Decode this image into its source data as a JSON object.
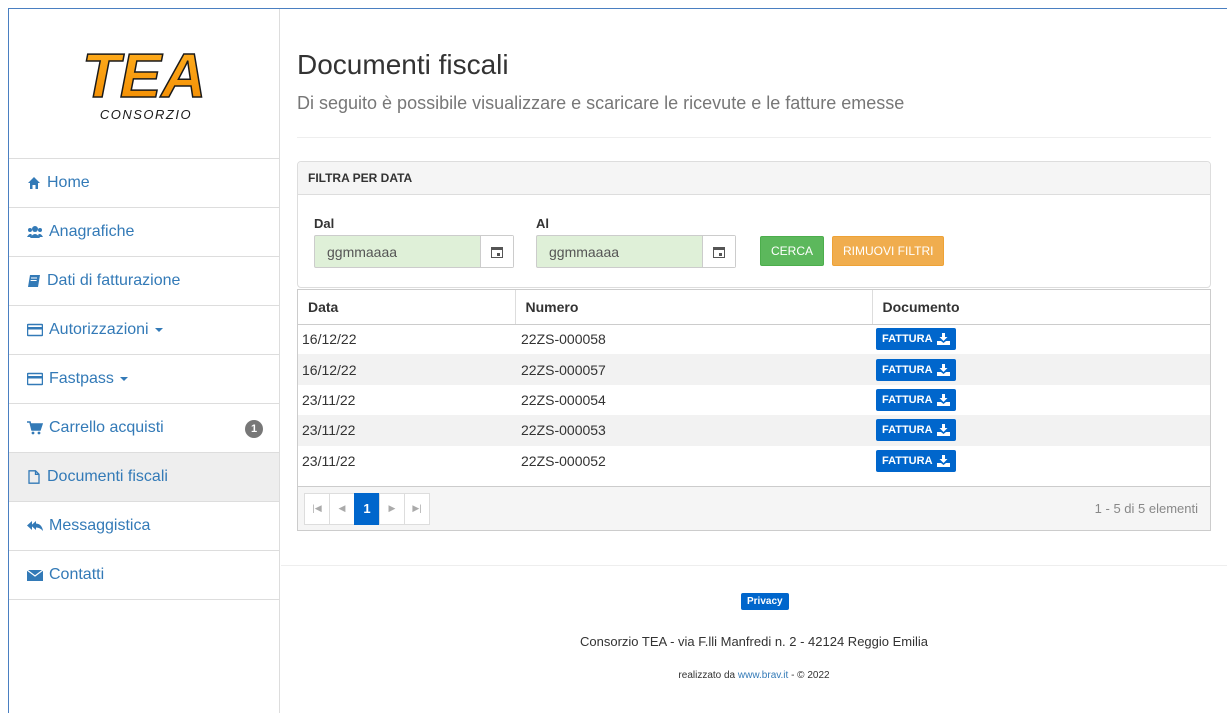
{
  "logo": {
    "wordmark": "TEA",
    "caption": "CONSORZIO"
  },
  "sidebar": {
    "items": [
      {
        "label": "Home",
        "icon": "home-icon"
      },
      {
        "label": "Anagrafiche",
        "icon": "users-icon"
      },
      {
        "label": "Dati di fatturazione",
        "icon": "book-icon"
      },
      {
        "label": "Autorizzazioni",
        "icon": "credit-card-icon"
      },
      {
        "label": "Fastpass",
        "icon": "credit-card-icon"
      },
      {
        "label": "Carrello acquisti",
        "icon": "cart-icon",
        "badge": "1"
      },
      {
        "label": "Documenti fiscali",
        "icon": "file-icon",
        "active": true
      },
      {
        "label": "Messaggistica",
        "icon": "reply-all-icon"
      },
      {
        "label": "Contatti",
        "icon": "envelope-icon"
      }
    ]
  },
  "header": {
    "title": "Documenti fiscali",
    "subtitle": "Di seguito è possibile visualizzare e scaricare le ricevute e le fatture emesse"
  },
  "filter": {
    "heading": "FILTRA PER DATA",
    "from_label": "Dal",
    "from_value": "ggmmaaaa",
    "to_label": "Al",
    "to_value": "ggmmaaaa",
    "search_label": "CERCA",
    "clear_label": "RIMUOVI FILTRI"
  },
  "table": {
    "headers": [
      "Data",
      "Numero",
      "Documento"
    ],
    "button_label": "FATTURA",
    "rows": [
      {
        "date": "16/12/22",
        "number": "22ZS-000058"
      },
      {
        "date": "16/12/22",
        "number": "22ZS-000057"
      },
      {
        "date": "23/11/22",
        "number": "22ZS-000054"
      },
      {
        "date": "23/11/22",
        "number": "22ZS-000053"
      },
      {
        "date": "23/11/22",
        "number": "22ZS-000052"
      }
    ]
  },
  "pager": {
    "current_page": "1",
    "info": "1 - 5 di 5 elementi"
  },
  "footer": {
    "privacy": "Privacy",
    "address": "Consorzio TEA - via F.lli Manfredi n. 2 - 42124 Reggio Emilia",
    "credits_prefix": "realizzato da ",
    "credits_link": "www.brav.it",
    "credits_suffix": " - © 2022"
  },
  "colors": {
    "link": "#337ab7",
    "primary": "#0066cc",
    "success": "#5cb85c",
    "warning": "#f0ad4e",
    "logo_orange": "#f7941d"
  }
}
